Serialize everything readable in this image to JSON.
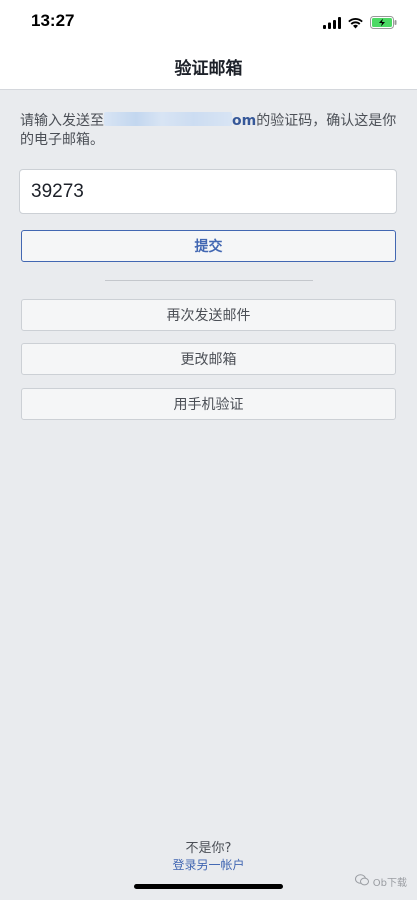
{
  "status_bar": {
    "time": "13:27",
    "icons": [
      "cellular-signal-icon",
      "wifi-icon",
      "battery-charging-icon"
    ],
    "battery_color": "#4cd964"
  },
  "nav": {
    "title": "验证邮箱"
  },
  "instruction": {
    "prefix": "请输入发送至",
    "email_suffix": "om",
    "suffix": "的验证码，确认这是你的电子邮箱。"
  },
  "code_input": {
    "value": "39273"
  },
  "buttons": {
    "submit": "提交",
    "resend": "再次发送邮件",
    "change_email": "更改邮箱",
    "verify_phone": "用手机验证"
  },
  "footer": {
    "question": "不是你?",
    "link": "登录另一帐户"
  },
  "watermark": {
    "text": "Ob下载"
  },
  "colors": {
    "accent": "#4267b2",
    "background": "#e9ebee",
    "link": "#365899"
  }
}
